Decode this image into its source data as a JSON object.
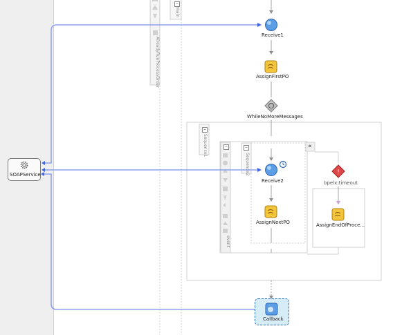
{
  "service": {
    "name": "SOAPService"
  },
  "scopes": {
    "main": "main",
    "sequence1": "Sequence1",
    "sequence2": "Sequence2",
    "event": "event",
    "palette": "AlreadyRunProcessOrder"
  },
  "activities": {
    "receive1": "Receive1",
    "assign_first": "AssignFirstPO",
    "while_loop": "WhileNoMoreMessages",
    "receive2": "Receive2",
    "assign_next": "AssignNextPO",
    "timeout": "bpelx:timeout",
    "assign_end": "AssignEndOfProce...",
    "callback": "Callback"
  },
  "colors": {
    "link": "#8ea0ee",
    "receive": "#5b9ee6",
    "assign": "#f2c53a",
    "error": "#e04848"
  }
}
